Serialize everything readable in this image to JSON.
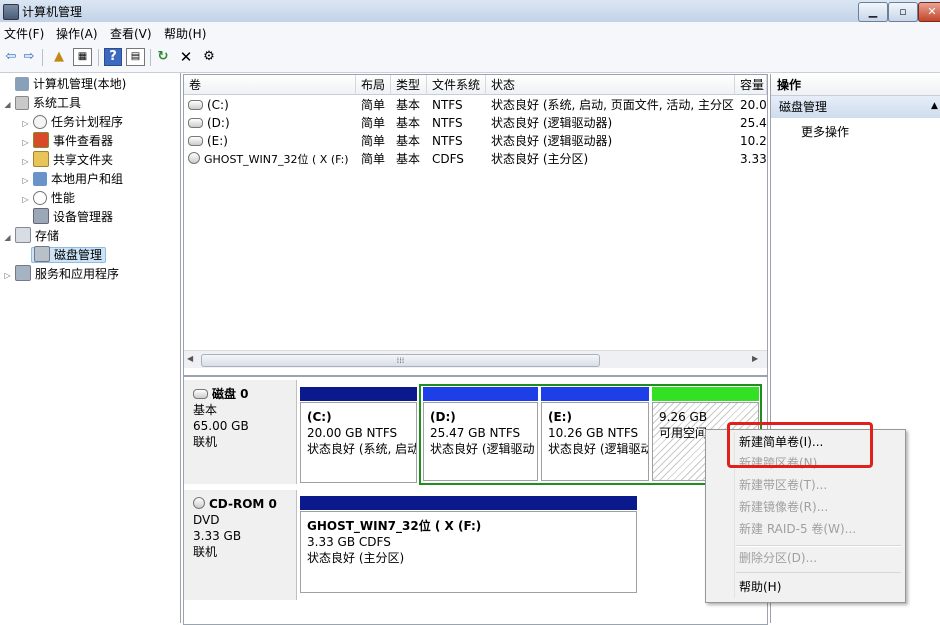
{
  "window": {
    "title": "计算机管理"
  },
  "menubar": [
    "文件(F)",
    "操作(A)",
    "查看(V)",
    "帮助(H)"
  ],
  "tree": [
    {
      "label": "计算机管理(本地)",
      "level": 0,
      "expander": "",
      "icon": "computer-icon"
    },
    {
      "label": "系统工具",
      "level": 1,
      "expander": "◢",
      "icon": "tools-icon"
    },
    {
      "label": "任务计划程序",
      "level": 2,
      "expander": "▷",
      "icon": "clock-icon"
    },
    {
      "label": "事件查看器",
      "level": 2,
      "expander": "▷",
      "icon": "event-viewer-icon"
    },
    {
      "label": "共享文件夹",
      "level": 2,
      "expander": "▷",
      "icon": "shared-folder-icon"
    },
    {
      "label": "本地用户和组",
      "level": 2,
      "expander": "▷",
      "icon": "users-icon"
    },
    {
      "label": "性能",
      "level": 2,
      "expander": "▷",
      "icon": "performance-icon"
    },
    {
      "label": "设备管理器",
      "level": 2,
      "expander": "",
      "icon": "device-manager-icon"
    },
    {
      "label": "存储",
      "level": 1,
      "expander": "◢",
      "icon": "storage-icon"
    },
    {
      "label": "磁盘管理",
      "level": 2,
      "expander": "",
      "icon": "disk-icon",
      "selected": true
    },
    {
      "label": "服务和应用程序",
      "level": 1,
      "expander": "▷",
      "icon": "services-icon"
    }
  ],
  "volumes": {
    "headers": [
      "卷",
      "布局",
      "类型",
      "文件系统",
      "状态",
      "容量"
    ],
    "rows": [
      [
        "(C:)",
        "简单",
        "基本",
        "NTFS",
        "状态良好 (系统, 启动, 页面文件, 活动, 主分区)",
        "20.0"
      ],
      [
        "(D:)",
        "简单",
        "基本",
        "NTFS",
        "状态良好 (逻辑驱动器)",
        "25.4"
      ],
      [
        "(E:)",
        "简单",
        "基本",
        "NTFS",
        "状态良好 (逻辑驱动器)",
        "10.2"
      ],
      [
        "GHOST_WIN7_32位 ( X (F:)",
        "简单",
        "基本",
        "CDFS",
        "状态良好 (主分区)",
        "3.33"
      ]
    ],
    "scroll_grip": "⁞⁞⁞"
  },
  "actions": {
    "header": "操作",
    "section": "磁盘管理",
    "more": "更多操作"
  },
  "disk0": {
    "name": "磁盘 0",
    "type": "基本",
    "size": "65.00 GB",
    "status": "联机",
    "partitions": [
      {
        "name": "(C:)",
        "size": "20.00 GB NTFS",
        "status": "状态良好 (系统, 启动"
      },
      {
        "name": "(D:)",
        "size": "25.47 GB NTFS",
        "status": "状态良好 (逻辑驱动"
      },
      {
        "name": "(E:)",
        "size": "10.26 GB NTFS",
        "status": "状态良好 (逻辑驱动"
      },
      {
        "name": "",
        "size": "9.26 GB",
        "status": "可用空间"
      }
    ]
  },
  "cdrom0": {
    "name": "CD-ROM 0",
    "type": "DVD",
    "size": "3.33 GB",
    "status": "联机",
    "partition": {
      "name": "GHOST_WIN7_32位 ( X  (F:)",
      "size": "3.33 GB CDFS",
      "status": "状态良好 (主分区)"
    }
  },
  "context_menu": [
    {
      "label": "新建简单卷(I)...",
      "enabled": true
    },
    {
      "label": "新建跨区卷(N)...",
      "enabled": false
    },
    {
      "label": "新建带区卷(T)...",
      "enabled": false
    },
    {
      "label": "新建镜像卷(R)...",
      "enabled": false
    },
    {
      "label": "新建 RAID-5 卷(W)...",
      "enabled": false
    },
    {
      "label": "删除分区(D)...",
      "enabled": false
    },
    {
      "label": "帮助(H)",
      "enabled": true
    }
  ],
  "colors": {
    "primary_bar": "#0a1a8c",
    "logical_bar": "#1c3fe8",
    "free_bar": "#33e023",
    "extended_border": "#1e8f1e",
    "highlight": "#e0201c"
  },
  "window_buttons": {
    "minimize": "▁",
    "maximize": "▫",
    "close": "✕"
  },
  "toolbar_glyphs": {
    "back": "⇦",
    "forward": "⇨",
    "up": "▲",
    "show_hide": "▦",
    "help": "?",
    "properties": "▤",
    "refresh": "↻",
    "delete": "✕",
    "settings": "⚙"
  }
}
